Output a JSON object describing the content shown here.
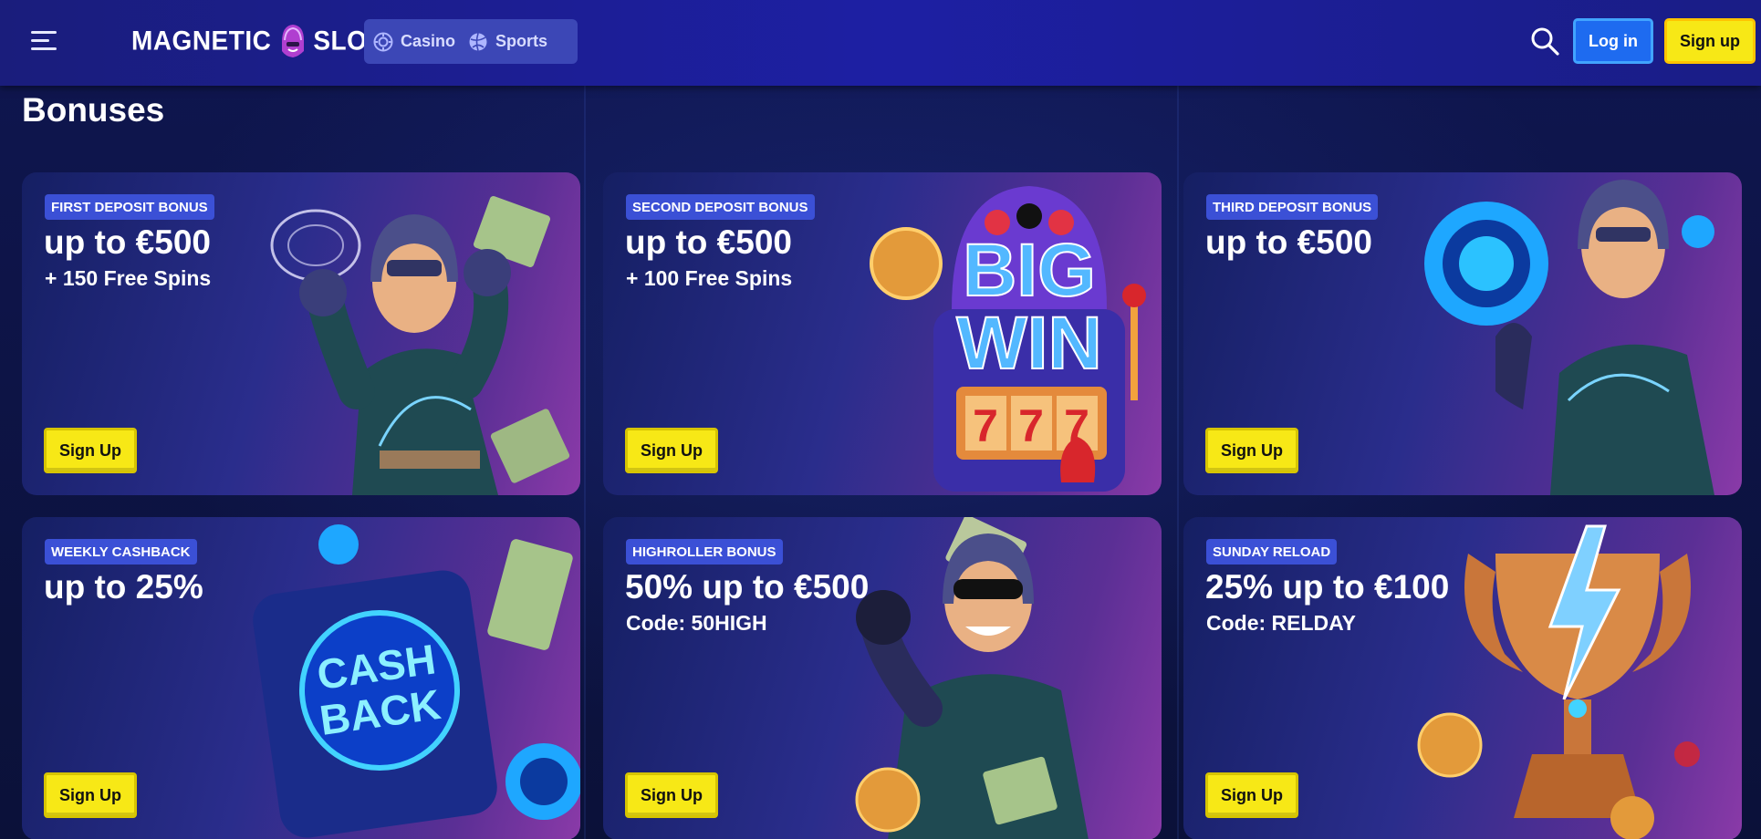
{
  "header": {
    "logo_left": "MAGNETIC",
    "logo_right": "SLOTS",
    "nav": [
      {
        "label": "Casino",
        "icon": "casino-chip-icon"
      },
      {
        "label": "Sports",
        "icon": "ball-icon"
      }
    ],
    "search_icon": "search-icon",
    "login_label": "Log in",
    "signup_label": "Sign up",
    "colors": {
      "header_bg": "#1d1fa3",
      "login": "#1e6bf0",
      "signup": "#f7e816"
    }
  },
  "page": {
    "title": "Bonuses"
  },
  "cards": [
    {
      "badge": "FIRST DEPOSIT BONUS",
      "amount": "up to €500",
      "extra": "+ 150 Free Spins",
      "cta": "Sign Up",
      "art": "magneto-hero"
    },
    {
      "badge": "SECOND DEPOSIT BONUS",
      "amount": "up to €500",
      "extra": "+ 100 Free Spins",
      "cta": "Sign Up",
      "art": "big-win-slot-machine"
    },
    {
      "badge": "THIRD DEPOSIT BONUS",
      "amount": "up to €500",
      "extra": "",
      "cta": "Sign Up",
      "art": "hero-with-chip"
    },
    {
      "badge": "WEEKLY CASHBACK",
      "amount": "up to 25%",
      "extra": "",
      "cta": "Sign Up",
      "art": "cashback-device"
    },
    {
      "badge": "HIGHROLLER BONUS",
      "amount": "50% up to €500",
      "extra": "Code: 50HIGH",
      "cta": "Sign Up",
      "art": "hero-sunglasses"
    },
    {
      "badge": "SUNDAY RELOAD",
      "amount": "25% up to €100",
      "extra": "Code: RELDAY",
      "cta": "Sign Up",
      "art": "trophy-lightning"
    }
  ]
}
